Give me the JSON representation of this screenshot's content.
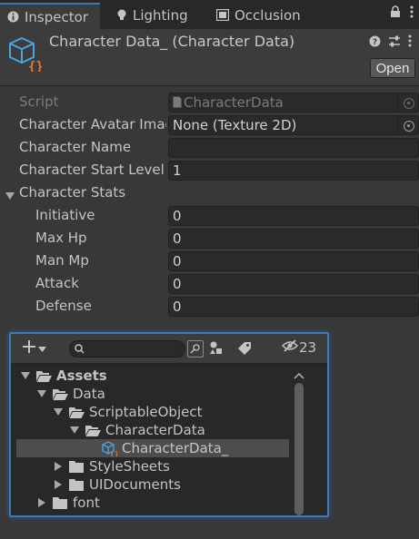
{
  "tabs": [
    {
      "label": "Inspector",
      "active": true
    },
    {
      "label": "Lighting",
      "active": false
    },
    {
      "label": "Occlusion",
      "active": false
    }
  ],
  "header": {
    "title": "Character Data_ (Character Data)",
    "open_label": "Open"
  },
  "fields": {
    "script": {
      "label": "Script",
      "value": "CharacterData"
    },
    "avatar": {
      "label": "Character Avatar Imag",
      "value": "None (Texture 2D)"
    },
    "name": {
      "label": "Character Name",
      "value": ""
    },
    "start_level": {
      "label": "Character Start Level",
      "value": "1"
    },
    "stats_header": {
      "label": "Character Stats"
    },
    "initiative": {
      "label": "Initiative",
      "value": "0"
    },
    "max_hp": {
      "label": "Max Hp",
      "value": "0"
    },
    "man_mp": {
      "label": "Man Mp",
      "value": "0"
    },
    "attack": {
      "label": "Attack",
      "value": "0"
    },
    "defense": {
      "label": "Defense",
      "value": "0"
    }
  },
  "project": {
    "hidden_count": "23",
    "tree": [
      {
        "label": "Assets",
        "depth": 0,
        "expanded": true,
        "bold": true,
        "type": "folder"
      },
      {
        "label": "Data",
        "depth": 1,
        "expanded": true,
        "type": "folder"
      },
      {
        "label": "ScriptableObject",
        "depth": 2,
        "expanded": true,
        "type": "folder"
      },
      {
        "label": "CharacterData",
        "depth": 3,
        "expanded": true,
        "type": "folder"
      },
      {
        "label": "CharacterData_",
        "depth": 4,
        "selected": true,
        "type": "asset"
      },
      {
        "label": "StyleSheets",
        "depth": 2,
        "expanded": false,
        "type": "folder"
      },
      {
        "label": "UIDocuments",
        "depth": 2,
        "expanded": false,
        "type": "folder"
      },
      {
        "label": "font",
        "depth": 1,
        "expanded": false,
        "type": "folder"
      }
    ]
  },
  "colors": {
    "accent": "#3a79bb",
    "panel": "#383838",
    "field": "#2a2a2a",
    "asset_icon": "#4aa3df",
    "script_badge": "#e8762d"
  }
}
